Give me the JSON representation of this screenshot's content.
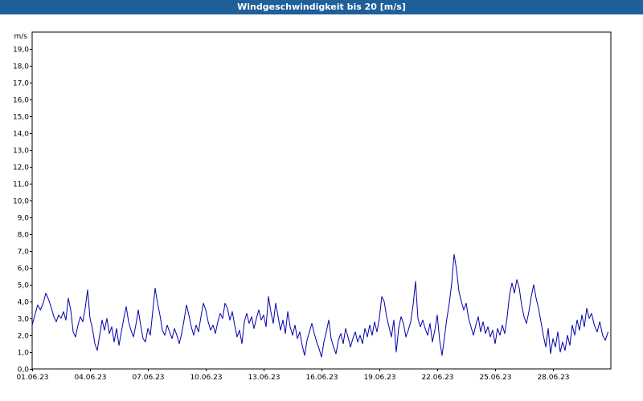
{
  "window": {
    "title": "Windgeschwindigkeit bis 20 [m/s]"
  },
  "colors": {
    "title_bar": "#1f5f9a",
    "title_text": "#ffffff",
    "line": "#0000aa",
    "grid": "#000000",
    "background": "#ffffff"
  },
  "chart_data": {
    "type": "line",
    "title": "Windgeschwindigkeit bis 20 [m/s]",
    "ylabel": "m/s",
    "xlabel": "",
    "ylim": [
      0,
      20
    ],
    "xlim": [
      "01.06.23",
      "01.07.23"
    ],
    "grid": true,
    "y_ticks": [
      "0,0",
      "1,0",
      "2,0",
      "3,0",
      "4,0",
      "5,0",
      "6,0",
      "7,0",
      "8,0",
      "9,0",
      "10,0",
      "11,0",
      "12,0",
      "13,0",
      "14,0",
      "15,0",
      "16,0",
      "17,0",
      "18,0",
      "19,0"
    ],
    "x_ticks": [
      "01.06.23",
      "04.06.23",
      "07.06.23",
      "10.06.23",
      "13.06.23",
      "16.06.23",
      "19.06.23",
      "22.06.23",
      "25.06.23",
      "28.06.23"
    ],
    "series": [
      {
        "name": "",
        "x_unit": "date, 2023-06",
        "points": [
          [
            "01.06.23",
            2.6
          ],
          [
            "01.06.23",
            3.2
          ],
          [
            "01.06.23",
            3.8
          ],
          [
            "01.06.23",
            3.5
          ],
          [
            "01.06.23",
            3.9
          ],
          [
            "01.06.23",
            4.5
          ],
          [
            "01.06.23",
            4.1
          ],
          [
            "02.06.23",
            3.6
          ],
          [
            "02.06.23",
            3.1
          ],
          [
            "02.06.23",
            2.8
          ],
          [
            "02.06.23",
            3.2
          ],
          [
            "02.06.23",
            3.0
          ],
          [
            "02.06.23",
            3.4
          ],
          [
            "02.06.23",
            2.9
          ],
          [
            "02.06.23",
            4.2
          ],
          [
            "03.06.23",
            3.5
          ],
          [
            "03.06.23",
            2.2
          ],
          [
            "03.06.23",
            1.9
          ],
          [
            "03.06.23",
            2.6
          ],
          [
            "03.06.23",
            3.1
          ],
          [
            "03.06.23",
            2.8
          ],
          [
            "03.06.23",
            3.6
          ],
          [
            "03.06.23",
            4.7
          ],
          [
            "04.06.23",
            3.0
          ],
          [
            "04.06.23",
            2.4
          ],
          [
            "04.06.23",
            1.5
          ],
          [
            "04.06.23",
            1.1
          ],
          [
            "04.06.23",
            2.0
          ],
          [
            "04.06.23",
            2.9
          ],
          [
            "04.06.23",
            2.3
          ],
          [
            "04.06.23",
            3.0
          ],
          [
            "05.06.23",
            2.1
          ],
          [
            "05.06.23",
            2.5
          ],
          [
            "05.06.23",
            1.6
          ],
          [
            "05.06.23",
            2.4
          ],
          [
            "05.06.23",
            1.4
          ],
          [
            "05.06.23",
            2.2
          ],
          [
            "05.06.23",
            3.0
          ],
          [
            "05.06.23",
            3.7
          ],
          [
            "06.06.23",
            2.8
          ],
          [
            "06.06.23",
            2.3
          ],
          [
            "06.06.23",
            1.9
          ],
          [
            "06.06.23",
            2.6
          ],
          [
            "06.06.23",
            3.5
          ],
          [
            "06.06.23",
            2.6
          ],
          [
            "06.06.23",
            1.8
          ],
          [
            "06.06.23",
            1.6
          ],
          [
            "07.06.23",
            2.4
          ],
          [
            "07.06.23",
            2.0
          ],
          [
            "07.06.23",
            3.4
          ],
          [
            "07.06.23",
            4.8
          ],
          [
            "07.06.23",
            3.9
          ],
          [
            "07.06.23",
            3.2
          ],
          [
            "07.06.23",
            2.3
          ],
          [
            "07.06.23",
            2.0
          ],
          [
            "08.06.23",
            2.6
          ],
          [
            "08.06.23",
            2.2
          ],
          [
            "08.06.23",
            1.8
          ],
          [
            "08.06.23",
            2.4
          ],
          [
            "08.06.23",
            2.0
          ],
          [
            "08.06.23",
            1.5
          ],
          [
            "08.06.23",
            2.1
          ],
          [
            "08.06.23",
            2.9
          ],
          [
            "09.06.23",
            3.8
          ],
          [
            "09.06.23",
            3.2
          ],
          [
            "09.06.23",
            2.5
          ],
          [
            "09.06.23",
            2.0
          ],
          [
            "09.06.23",
            2.6
          ],
          [
            "09.06.23",
            2.2
          ],
          [
            "09.06.23",
            3.1
          ],
          [
            "09.06.23",
            3.9
          ],
          [
            "10.06.23",
            3.5
          ],
          [
            "10.06.23",
            2.8
          ],
          [
            "10.06.23",
            2.3
          ],
          [
            "10.06.23",
            2.6
          ],
          [
            "10.06.23",
            2.1
          ],
          [
            "10.06.23",
            2.8
          ],
          [
            "10.06.23",
            3.3
          ],
          [
            "10.06.23",
            3.0
          ],
          [
            "11.06.23",
            3.9
          ],
          [
            "11.06.23",
            3.6
          ],
          [
            "11.06.23",
            2.9
          ],
          [
            "11.06.23",
            3.4
          ],
          [
            "11.06.23",
            2.6
          ],
          [
            "11.06.23",
            1.9
          ],
          [
            "11.06.23",
            2.3
          ],
          [
            "11.06.23",
            1.5
          ],
          [
            "12.06.23",
            2.8
          ],
          [
            "12.06.23",
            3.3
          ],
          [
            "12.06.23",
            2.7
          ],
          [
            "12.06.23",
            3.1
          ],
          [
            "12.06.23",
            2.4
          ],
          [
            "12.06.23",
            3.0
          ],
          [
            "12.06.23",
            3.5
          ],
          [
            "12.06.23",
            2.9
          ],
          [
            "13.06.23",
            3.2
          ],
          [
            "13.06.23",
            2.5
          ],
          [
            "13.06.23",
            4.3
          ],
          [
            "13.06.23",
            3.4
          ],
          [
            "13.06.23",
            2.7
          ],
          [
            "13.06.23",
            3.9
          ],
          [
            "13.06.23",
            3.1
          ],
          [
            "13.06.23",
            2.3
          ],
          [
            "14.06.23",
            2.9
          ],
          [
            "14.06.23",
            2.1
          ],
          [
            "14.06.23",
            3.4
          ],
          [
            "14.06.23",
            2.5
          ],
          [
            "14.06.23",
            2.0
          ],
          [
            "14.06.23",
            2.6
          ],
          [
            "14.06.23",
            1.8
          ],
          [
            "14.06.23",
            2.2
          ],
          [
            "15.06.23",
            1.4
          ],
          [
            "15.06.23",
            0.8
          ],
          [
            "15.06.23",
            1.7
          ],
          [
            "15.06.23",
            2.2
          ],
          [
            "15.06.23",
            2.7
          ],
          [
            "15.06.23",
            2.1
          ],
          [
            "15.06.23",
            1.6
          ],
          [
            "15.06.23",
            1.2
          ],
          [
            "16.06.23",
            0.7
          ],
          [
            "16.06.23",
            1.6
          ],
          [
            "16.06.23",
            2.2
          ],
          [
            "16.06.23",
            2.9
          ],
          [
            "16.06.23",
            1.8
          ],
          [
            "16.06.23",
            1.3
          ],
          [
            "16.06.23",
            0.9
          ],
          [
            "16.06.23",
            1.7
          ],
          [
            "17.06.23",
            2.1
          ],
          [
            "17.06.23",
            1.5
          ],
          [
            "17.06.23",
            2.4
          ],
          [
            "17.06.23",
            1.9
          ],
          [
            "17.06.23",
            1.3
          ],
          [
            "17.06.23",
            1.8
          ],
          [
            "17.06.23",
            2.2
          ],
          [
            "17.06.23",
            1.6
          ],
          [
            "18.06.23",
            2.0
          ],
          [
            "18.06.23",
            1.5
          ],
          [
            "18.06.23",
            2.4
          ],
          [
            "18.06.23",
            1.9
          ],
          [
            "18.06.23",
            2.6
          ],
          [
            "18.06.23",
            2.0
          ],
          [
            "18.06.23",
            2.8
          ],
          [
            "18.06.23",
            2.2
          ],
          [
            "19.06.23",
            3.0
          ],
          [
            "19.06.23",
            4.3
          ],
          [
            "19.06.23",
            4.0
          ],
          [
            "19.06.23",
            3.1
          ],
          [
            "19.06.23",
            2.5
          ],
          [
            "19.06.23",
            1.9
          ],
          [
            "19.06.23",
            2.9
          ],
          [
            "19.06.23",
            1.0
          ],
          [
            "20.06.23",
            2.4
          ],
          [
            "20.06.23",
            3.1
          ],
          [
            "20.06.23",
            2.7
          ],
          [
            "20.06.23",
            1.9
          ],
          [
            "20.06.23",
            2.3
          ],
          [
            "20.06.23",
            2.8
          ],
          [
            "20.06.23",
            3.8
          ],
          [
            "20.06.23",
            5.2
          ],
          [
            "21.06.23",
            3.0
          ],
          [
            "21.06.23",
            2.5
          ],
          [
            "21.06.23",
            2.9
          ],
          [
            "21.06.23",
            2.4
          ],
          [
            "21.06.23",
            2.0
          ],
          [
            "21.06.23",
            2.7
          ],
          [
            "21.06.23",
            1.6
          ],
          [
            "21.06.23",
            2.3
          ],
          [
            "22.06.23",
            3.2
          ],
          [
            "22.06.23",
            1.7
          ],
          [
            "22.06.23",
            0.8
          ],
          [
            "22.06.23",
            1.9
          ],
          [
            "22.06.23",
            3.0
          ],
          [
            "22.06.23",
            3.9
          ],
          [
            "22.06.23",
            5.1
          ],
          [
            "22.06.23",
            6.8
          ],
          [
            "23.06.23",
            5.9
          ],
          [
            "23.06.23",
            4.6
          ],
          [
            "23.06.23",
            4.0
          ],
          [
            "23.06.23",
            3.5
          ],
          [
            "23.06.23",
            3.9
          ],
          [
            "23.06.23",
            3.0
          ],
          [
            "23.06.23",
            2.5
          ],
          [
            "23.06.23",
            2.0
          ],
          [
            "24.06.23",
            2.6
          ],
          [
            "24.06.23",
            3.1
          ],
          [
            "24.06.23",
            2.2
          ],
          [
            "24.06.23",
            2.8
          ],
          [
            "24.06.23",
            2.1
          ],
          [
            "24.06.23",
            2.5
          ],
          [
            "24.06.23",
            1.9
          ],
          [
            "24.06.23",
            2.3
          ],
          [
            "25.06.23",
            1.5
          ],
          [
            "25.06.23",
            2.4
          ],
          [
            "25.06.23",
            2.0
          ],
          [
            "25.06.23",
            2.6
          ],
          [
            "25.06.23",
            2.1
          ],
          [
            "25.06.23",
            3.1
          ],
          [
            "25.06.23",
            4.4
          ],
          [
            "25.06.23",
            5.1
          ],
          [
            "26.06.23",
            4.5
          ],
          [
            "26.06.23",
            5.3
          ],
          [
            "26.06.23",
            4.8
          ],
          [
            "26.06.23",
            3.8
          ],
          [
            "26.06.23",
            3.1
          ],
          [
            "26.06.23",
            2.7
          ],
          [
            "26.06.23",
            3.4
          ],
          [
            "26.06.23",
            4.3
          ],
          [
            "27.06.23",
            5.0
          ],
          [
            "27.06.23",
            4.2
          ],
          [
            "27.06.23",
            3.6
          ],
          [
            "27.06.23",
            2.8
          ],
          [
            "27.06.23",
            2.0
          ],
          [
            "27.06.23",
            1.3
          ],
          [
            "27.06.23",
            2.4
          ],
          [
            "27.06.23",
            0.9
          ],
          [
            "28.06.23",
            1.8
          ],
          [
            "28.06.23",
            1.3
          ],
          [
            "28.06.23",
            2.2
          ],
          [
            "28.06.23",
            1.0
          ],
          [
            "28.06.23",
            1.6
          ],
          [
            "28.06.23",
            1.1
          ],
          [
            "28.06.23",
            2.0
          ],
          [
            "28.06.23",
            1.4
          ],
          [
            "29.06.23",
            2.6
          ],
          [
            "29.06.23",
            2.0
          ],
          [
            "29.06.23",
            2.9
          ],
          [
            "29.06.23",
            2.3
          ],
          [
            "29.06.23",
            3.2
          ],
          [
            "29.06.23",
            2.5
          ],
          [
            "29.06.23",
            3.6
          ],
          [
            "29.06.23",
            3.0
          ],
          [
            "30.06.23",
            3.3
          ],
          [
            "30.06.23",
            2.6
          ],
          [
            "30.06.23",
            2.2
          ],
          [
            "30.06.23",
            2.8
          ],
          [
            "30.06.23",
            2.0
          ],
          [
            "30.06.23",
            1.7
          ],
          [
            "30.06.23",
            2.2
          ]
        ]
      }
    ]
  }
}
